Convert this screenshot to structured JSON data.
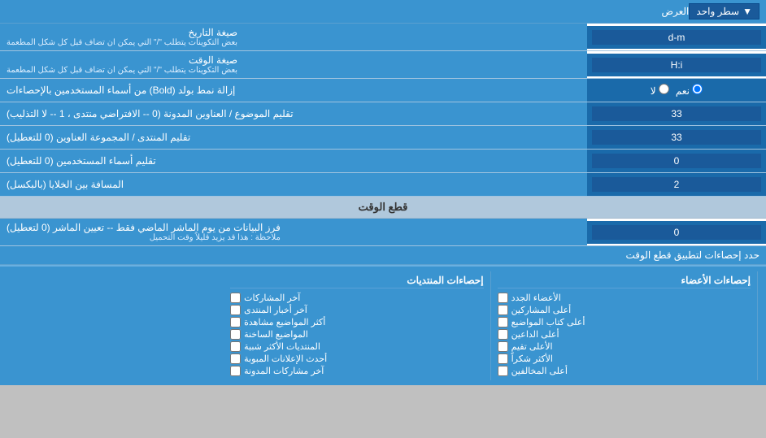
{
  "page": {
    "title": "العرض",
    "rows": [
      {
        "id": "single_line",
        "label": "العرض",
        "input_type": "dropdown",
        "value": "سطر واحد"
      },
      {
        "id": "date_format",
        "label": "صيغة التاريخ",
        "sublabel": "بعض التكوينات يتطلب \"/\" التي يمكن ان تضاف قبل كل شكل المطعمة",
        "input_type": "text",
        "value": "d-m"
      },
      {
        "id": "time_format",
        "label": "صيغة الوقت",
        "sublabel": "بعض التكوينات يتطلب \"/\" التي يمكن ان تضاف قبل كل شكل المطعمة",
        "input_type": "text",
        "value": "H:i"
      },
      {
        "id": "remove_bold",
        "label": "إزالة نمط بولد (Bold) من أسماء المستخدمين بالإحصاءات",
        "input_type": "radio",
        "options": [
          "نعم",
          "لا"
        ],
        "selected": "نعم"
      },
      {
        "id": "topics_titles",
        "label": "تقليم الموضوع / العناوين المدونة (0 -- الافتراضي منتدى ، 1 -- لا التذليب)",
        "input_type": "text",
        "value": "33"
      },
      {
        "id": "forum_titles",
        "label": "تقليم المنتدى / المجموعة العناوين (0 للتعطيل)",
        "input_type": "text",
        "value": "33"
      },
      {
        "id": "usernames",
        "label": "تقليم أسماء المستخدمين (0 للتعطيل)",
        "input_type": "text",
        "value": "0"
      },
      {
        "id": "cell_spacing",
        "label": "المسافة بين الخلايا (بالبكسل)",
        "input_type": "text",
        "value": "2"
      }
    ],
    "cutoff_section": {
      "title": "قطع الوقت",
      "row": {
        "id": "cutoff_value",
        "label": "فرز البيانات من يوم الماشر الماضي فقط -- تعيين الماشر (0 لتعطيل)",
        "sublabel": "ملاحظة : هذا قد يزيد قليلاً وقت التحميل",
        "input_type": "text",
        "value": "0"
      }
    },
    "stats_section": {
      "limit_label": "حدد إحصاءات لتطبيق قطع الوقت",
      "columns": [
        {
          "title": "",
          "items": []
        },
        {
          "title": "إحصاءات المنتديات",
          "items": [
            "آخر المشاركات",
            "آخر أخبار المنتدى",
            "أكثر المواضيع مشاهدة",
            "المواضيع الساخنة",
            "المنتديات الأكثر شبية",
            "أحدث الإعلانات المبوبة",
            "آخر مشاركات المدونة"
          ]
        },
        {
          "title": "إحصاءات الأعضاء",
          "items": [
            "الأعضاء الجدد",
            "أعلى المشاركين",
            "أعلى كتاب المواضيع",
            "أعلى الداعين",
            "الأعلى تقيم",
            "الأكثر شكراً",
            "أعلى المخالفين"
          ]
        }
      ]
    }
  }
}
